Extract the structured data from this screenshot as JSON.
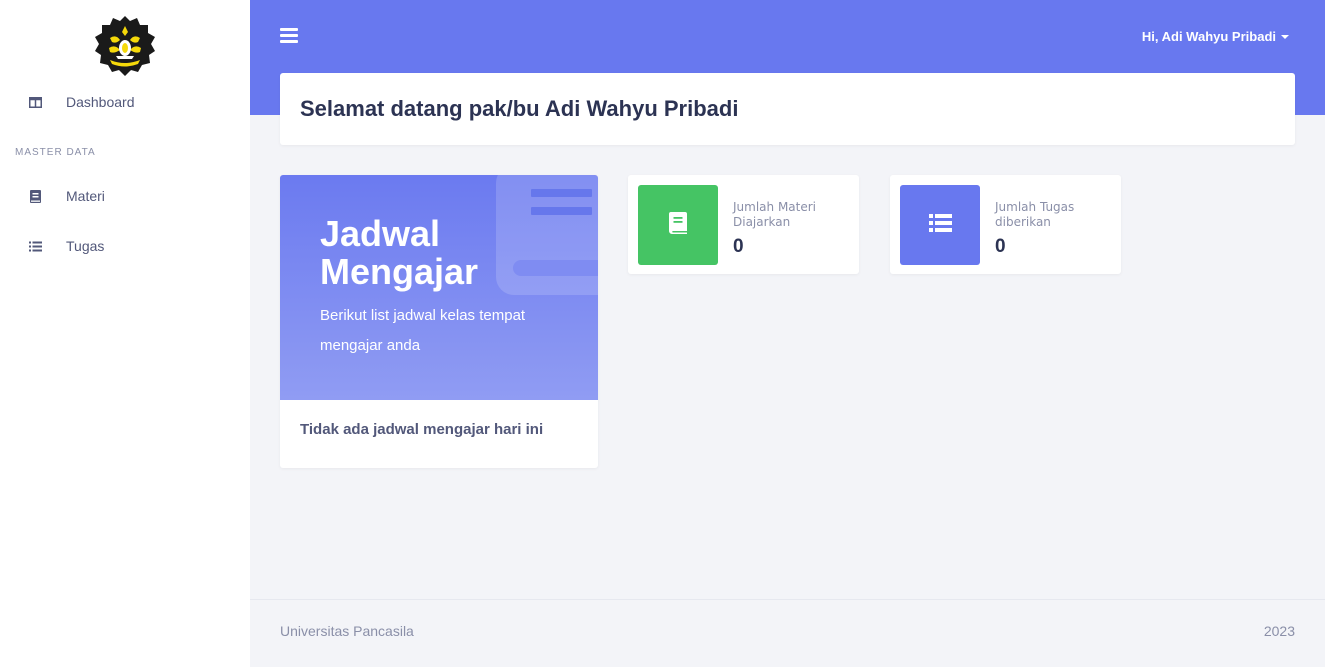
{
  "header": {
    "user_greeting": "Hi, Adi Wahyu Pribadi",
    "welcome_title": "Selamat datang pak/bu Adi Wahyu Pribadi"
  },
  "sidebar": {
    "logo_icon": "university-logo",
    "section_heading": "MASTER DATA",
    "items": [
      {
        "label": "Dashboard",
        "icon": "columns-icon"
      },
      {
        "label": "Materi",
        "icon": "book-icon"
      },
      {
        "label": "Tugas",
        "icon": "list-icon"
      }
    ]
  },
  "schedule": {
    "title": "Jadwal Mengajar",
    "subtitle": "Berikut list jadwal kelas tempat mengajar anda",
    "empty_message": "Tidak ada jadwal mengajar hari ini"
  },
  "stats": [
    {
      "label": "Jumlah Materi Diajarkan",
      "value": "0",
      "icon": "book-icon",
      "color": "#45c464"
    },
    {
      "label": "Jumlah Tugas diberikan",
      "value": "0",
      "icon": "list-icon",
      "color": "#6878ef"
    }
  ],
  "footer": {
    "left": "Universitas Pancasila",
    "right": "2023"
  },
  "colors": {
    "accent": "#6878ef",
    "success": "#45c464",
    "background": "#f3f4f8"
  }
}
